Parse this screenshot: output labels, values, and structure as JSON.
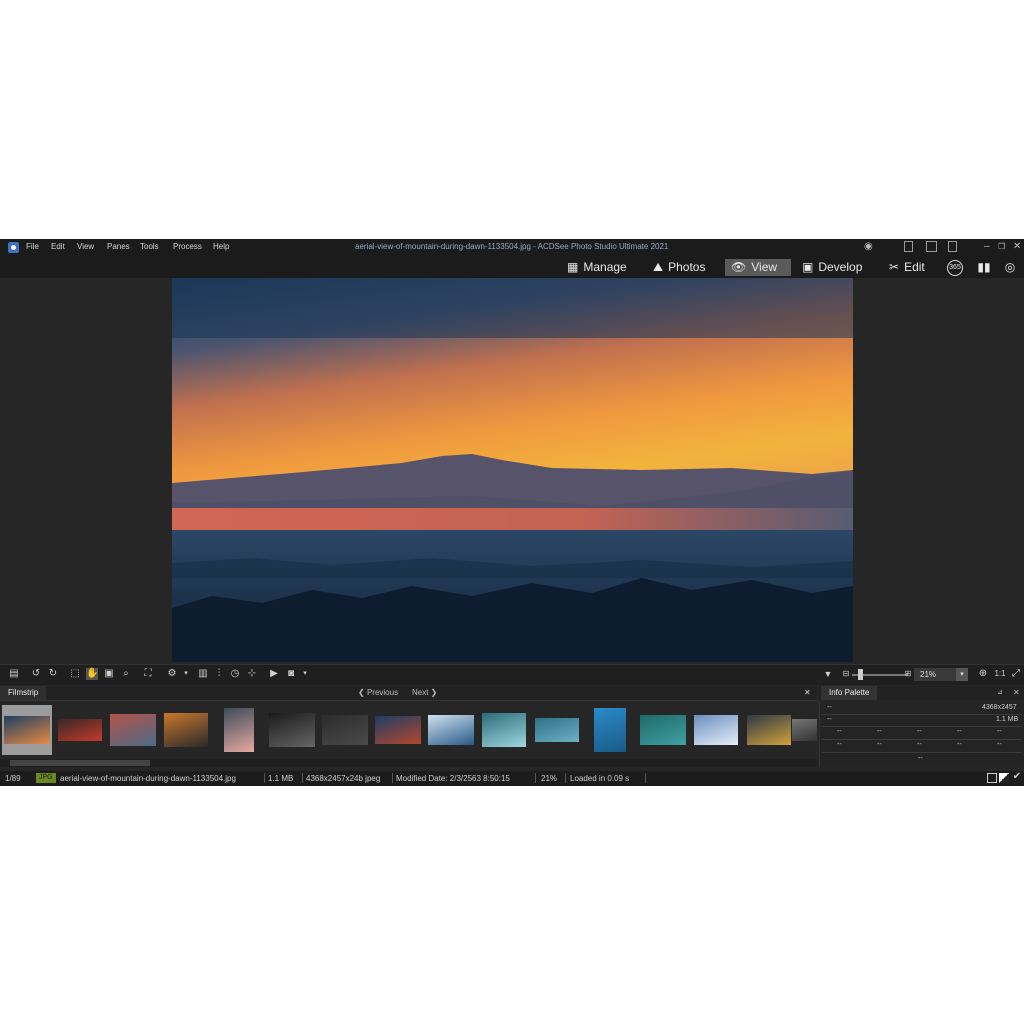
{
  "window": {
    "title": "aerial-view-of-mountain-during-dawn-1133504.jpg - ACDSee Photo Studio Ultimate 2021",
    "menu": [
      "File",
      "Edit",
      "View",
      "Panes",
      "Tools",
      "Process",
      "Help"
    ]
  },
  "modes": {
    "manage": "Manage",
    "photos": "Photos",
    "view": "View",
    "develop": "Develop",
    "edit": "Edit",
    "extra_icons": [
      "365-icon",
      "dashboard-icon",
      "eye-settings-icon"
    ]
  },
  "toolbar": {
    "zoom": "21%",
    "ratio": "1:1"
  },
  "filmstrip": {
    "tab": "Filmstrip",
    "previous": "Previous",
    "next": "Next",
    "close": "✕",
    "thumbnails": [
      {
        "colors": [
          "#1d3f63",
          "#e98a45"
        ]
      },
      {
        "colors": [
          "#3a2626",
          "#c23b2b"
        ]
      },
      {
        "colors": [
          "#b2534a",
          "#4e6b86"
        ]
      },
      {
        "colors": [
          "#c9772d",
          "#2a2a2a"
        ]
      },
      {
        "colors": [
          "#3d4b58",
          "#e5a9a3"
        ]
      },
      {
        "colors": [
          "#1a1a1a",
          "#666666"
        ]
      },
      {
        "colors": [
          "#2c2c2c",
          "#4a4a4a"
        ]
      },
      {
        "colors": [
          "#1c3d66",
          "#b6482d"
        ]
      },
      {
        "colors": [
          "#cfe1f2",
          "#2a5a86"
        ]
      },
      {
        "colors": [
          "#2b6c78",
          "#9ed6de"
        ]
      },
      {
        "colors": [
          "#2f6f8a",
          "#6fb0c4"
        ]
      },
      {
        "colors": [
          "#2a8bc8",
          "#1b5a8a"
        ]
      },
      {
        "colors": [
          "#1f6a6a",
          "#3fa0a0"
        ]
      },
      {
        "colors": [
          "#6a8fbf",
          "#e6eef8"
        ]
      },
      {
        "colors": [
          "#2d3846",
          "#d2a23b"
        ]
      },
      {
        "colors": [
          "#777777",
          "#333333"
        ]
      }
    ]
  },
  "info_palette": {
    "title": "Info Palette",
    "dimensions": "4368x2457",
    "size": "1.1 MB",
    "placeholder": "--"
  },
  "status": {
    "index": "1/89",
    "type": "JPG",
    "filename": "aerial-view-of-mountain-during-dawn-1133504.jpg",
    "filesize": "1.1 MB",
    "dims": "4368x2457x24b jpeg",
    "modified": "Modified Date: 2/3/2563 8:50:15",
    "zoom": "21%",
    "loaded": "Loaded in 0.09 s"
  }
}
